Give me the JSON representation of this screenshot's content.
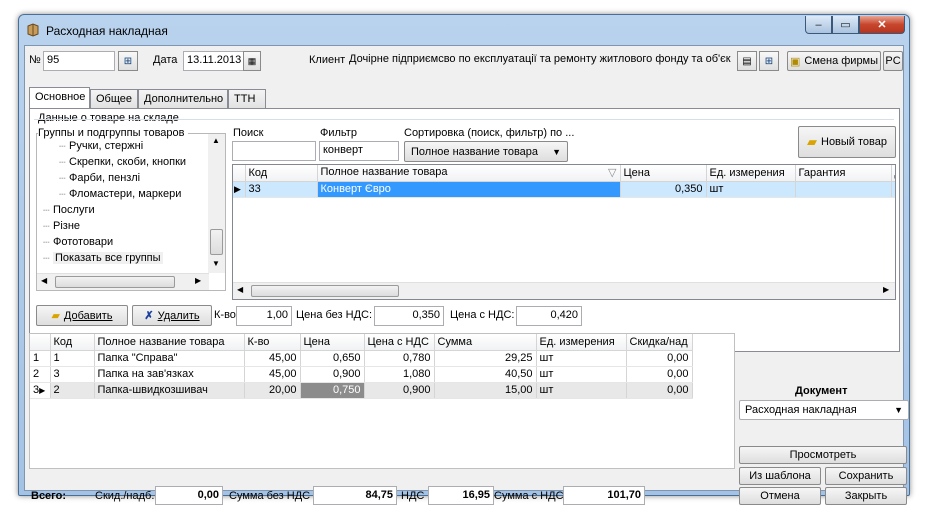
{
  "window": {
    "title": "Расходная накладная"
  },
  "header": {
    "number_label": "№",
    "number_value": "95",
    "date_label": "Дата",
    "date_value": "13.11.2013",
    "client_label": "Клиент",
    "client_value": "Дочірне підприємсво по експлуатації та ремонту житлового фонду та об'єк",
    "change_company_label": "Смена фирмы",
    "pc_label": "PC"
  },
  "tabs": [
    "Основное",
    "Общее",
    "Дополнительно",
    "ТТН"
  ],
  "stock": {
    "title": "Данные о товаре на складе",
    "groups_title": "Группы и подгруппы товаров",
    "groups": [
      {
        "label": "Ручки, стержні",
        "indent": 2
      },
      {
        "label": "Скрепки, скоби, кнопки",
        "indent": 2
      },
      {
        "label": "Фарби, пензлі",
        "indent": 2
      },
      {
        "label": "Фломастери, маркери",
        "indent": 2
      },
      {
        "label": "Послуги",
        "indent": 1
      },
      {
        "label": "Різне",
        "indent": 1
      },
      {
        "label": "Фототовари",
        "indent": 1
      },
      {
        "label": "Показать все группы",
        "indent": 1,
        "selected": true
      }
    ],
    "search_label": "Поиск",
    "search_value": "",
    "filter_label": "Фильтр",
    "filter_value": "конверт",
    "sort_label": "Сортировка (поиск, фильтр) по ...",
    "sort_value": "Полное название товара",
    "new_product_label": "Новый товар",
    "columns": [
      "Код",
      "Полное название товара",
      "Цена",
      "Ед. измерения",
      "Гарантия",
      "Д"
    ],
    "rows": [
      {
        "code": "33",
        "name": "Конверт Євро",
        "price": "0,350",
        "unit": "шт",
        "warranty": ""
      }
    ]
  },
  "actions": {
    "add_label": "Добавить",
    "delete_label": "Удалить",
    "qty_label": "К-во",
    "qty_value": "1,00",
    "price_no_vat_label": "Цена без НДС:",
    "price_no_vat_value": "0,350",
    "price_vat_label": "Цена с НДС:",
    "price_vat_value": "0,420"
  },
  "invoice": {
    "columns": [
      "Код",
      "Полное название товара",
      "К-во",
      "Цена",
      "Цена с НДС",
      "Сумма",
      "Ед. измерения",
      "Скидка/над"
    ],
    "rows": [
      {
        "n": "1",
        "code": "1",
        "name": "Папка \"Справа\"",
        "qty": "45,00",
        "price": "0,650",
        "price_vat": "0,780",
        "sum": "29,25",
        "unit": "шт",
        "discount": "0,00"
      },
      {
        "n": "2",
        "code": "3",
        "name": "Папка на зав'язках",
        "qty": "45,00",
        "price": "0,900",
        "price_vat": "1,080",
        "sum": "40,50",
        "unit": "шт",
        "discount": "0,00"
      },
      {
        "n": "3",
        "code": "2",
        "name": "Папка-швидкозшивач",
        "qty": "20,00",
        "price": "0,750",
        "price_vat": "0,900",
        "sum": "15,00",
        "unit": "шт",
        "discount": "0,00"
      }
    ]
  },
  "side": {
    "document_label": "Документ",
    "document_value": "Расходная накладная",
    "preview_label": "Просмотреть",
    "from_template_label": "Из шаблона",
    "save_label": "Сохранить",
    "cancel_label": "Отмена",
    "close_label": "Закрыть"
  },
  "totals": {
    "total_label": "Всего:",
    "discount_label": "Скид./надб.",
    "discount_value": "0,00",
    "sum_no_vat_label": "Сумма без НДС",
    "sum_no_vat_value": "84,75",
    "vat_label": "НДС",
    "vat_value": "16,95",
    "sum_vat_label": "Сумма с НДС",
    "sum_vat_value": "101,70"
  },
  "colors": {
    "selection": "#3399ff",
    "row_highlight": "#cce8ff",
    "title_gradient": "#b9d3ee"
  }
}
